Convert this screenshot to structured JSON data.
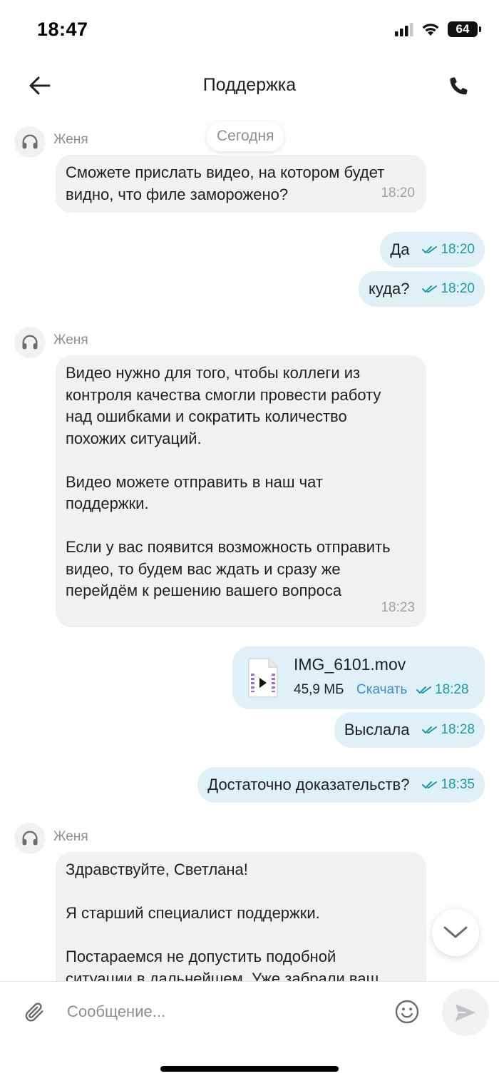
{
  "status_bar": {
    "time": "18:47",
    "battery": "64"
  },
  "header": {
    "title": "Поддержка"
  },
  "chat": {
    "date_divider": "Сегодня",
    "messages": [
      {
        "sender": "Женя",
        "text": "Сможете прислать видео, на котором будет\nвидно, что филе заморожено?",
        "time": "18:20"
      },
      {
        "text": "Да",
        "time": "18:20"
      },
      {
        "text": "куда?",
        "time": "18:20"
      },
      {
        "sender": "Женя",
        "text": "Видео нужно для того, чтобы коллеги из\nконтроля качества смогли провести работу\nнад ошибками и сократить количество\nпохожих ситуаций.\n\nВидео можете отправить в наш чат\nподдержки.\n\nЕсли у вас появится возможность отправить\nвидео, то будем вас ждать и сразу же\nперейдём к решению вашего вопроса",
        "time": "18:23"
      },
      {
        "file_name": "IMG_6101.mov",
        "file_size": "45,9 МБ",
        "download_label": "Скачать",
        "time": "18:28"
      },
      {
        "text": "Выслала",
        "time": "18:28"
      },
      {
        "text": "Достаточно доказательств?",
        "time": "18:35"
      },
      {
        "sender": "Женя",
        "text": "Здравствуйте, Светлана!\n\nЯ старший специалист поддержки.\n\nПостараемся не допустить подобной\nситуации в дальнейшем. Уже забрали ваш"
      }
    ]
  },
  "input": {
    "placeholder": "Сообщение..."
  },
  "colors": {
    "outgoing_bubble": "#dff1f7",
    "incoming_bubble": "#f1f1f3",
    "read_mark": "#1a9aaa",
    "link": "#3b8fd9"
  },
  "icons": [
    "back-arrow-icon",
    "phone-icon",
    "headset-icon",
    "double-check-icon",
    "video-file-icon",
    "chevron-down-icon",
    "paperclip-icon",
    "smiley-icon",
    "send-icon",
    "signal-icon",
    "wifi-icon",
    "battery-icon"
  ]
}
